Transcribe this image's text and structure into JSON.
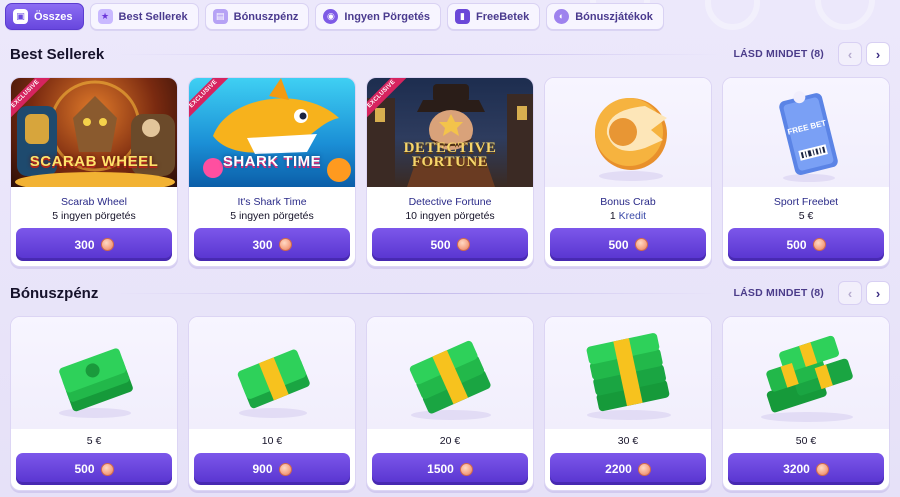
{
  "tabs": [
    {
      "label": "Összes",
      "icon": "all-icon",
      "active": true
    },
    {
      "label": "Best Sellerek",
      "icon": "star-icon",
      "active": false
    },
    {
      "label": "Bónuszpénz",
      "icon": "money-icon",
      "active": false
    },
    {
      "label": "Ingyen Pörgetés",
      "icon": "spin-icon",
      "active": false
    },
    {
      "label": "FreeBetek",
      "icon": "freebet-icon",
      "active": false
    },
    {
      "label": "Bónuszjátékok",
      "icon": "bonus-game-icon",
      "active": false
    }
  ],
  "sections": [
    {
      "title": "Best Sellerek",
      "see_all": "LÁSD MINDET (8)",
      "cards": [
        {
          "title": "Scarab Wheel",
          "sub_count": "5",
          "sub_text": "ingyen pörgetés",
          "price": "300",
          "badge": "EXCLUSIVE",
          "art_text": "SCARAB WHEEL"
        },
        {
          "title": "It's Shark Time",
          "sub_count": "5",
          "sub_text": "ingyen pörgetés",
          "price": "300",
          "badge": "EXCLUSIVE",
          "art_text": "SHARK TIME"
        },
        {
          "title": "Detective Fortune",
          "sub_count": "10",
          "sub_text": "ingyen pörgetés",
          "price": "500",
          "badge": "EXCLUSIVE",
          "art_text": "DETECTIVE FORTUNE"
        },
        {
          "title": "Bonus Crab",
          "sub_count": "1",
          "sub_text": "Kredit",
          "price": "500",
          "badge": "",
          "art_text": ""
        },
        {
          "title": "Sport Freebet",
          "sub_count": "5 €",
          "sub_text": "",
          "price": "500",
          "badge": "",
          "art_text": "FREE BET"
        }
      ]
    },
    {
      "title": "Bónuszpénz",
      "see_all": "LÁSD MINDET (8)",
      "cards": [
        {
          "amount": "5 €",
          "price": "500"
        },
        {
          "amount": "10 €",
          "price": "900"
        },
        {
          "amount": "20 €",
          "price": "1500"
        },
        {
          "amount": "30 €",
          "price": "2200"
        },
        {
          "amount": "50 €",
          "price": "3200"
        }
      ]
    }
  ],
  "nav": {
    "prev": "‹",
    "next": "›"
  },
  "colors": {
    "accent": "#6847de",
    "background": "#ece8fb",
    "coin": "#f7a88a",
    "exclusive": "#d6245f"
  }
}
